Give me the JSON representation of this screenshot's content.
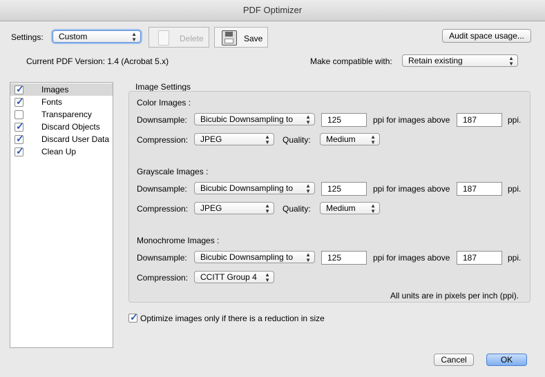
{
  "window": {
    "title": "PDF Optimizer"
  },
  "toolbar": {
    "settings_label": "Settings:",
    "settings_value": "Custom",
    "delete_label": "Delete",
    "save_label": "Save",
    "audit_label": "Audit space usage..."
  },
  "version": {
    "current": "Current PDF Version: 1.4 (Acrobat 5.x)",
    "compat_label": "Make compatible with:",
    "compat_value": "Retain existing"
  },
  "sidebar": {
    "items": [
      {
        "label": "Images",
        "checked": true,
        "selected": true
      },
      {
        "label": "Fonts",
        "checked": true,
        "selected": false
      },
      {
        "label": "Transparency",
        "checked": false,
        "selected": false
      },
      {
        "label": "Discard Objects",
        "checked": true,
        "selected": false
      },
      {
        "label": "Discard User Data",
        "checked": true,
        "selected": false
      },
      {
        "label": "Clean Up",
        "checked": true,
        "selected": false
      }
    ]
  },
  "image_settings": {
    "title": "Image Settings",
    "color": {
      "header": "Color Images :",
      "downsample_label": "Downsample:",
      "downsample_method": "Bicubic Downsampling to",
      "ppi": "125",
      "ppi_above_label": "ppi for images above",
      "above_ppi": "187",
      "ppi_unit": "ppi.",
      "compression_label": "Compression:",
      "compression": "JPEG",
      "quality_label": "Quality:",
      "quality": "Medium"
    },
    "grayscale": {
      "header": "Grayscale Images :",
      "downsample_label": "Downsample:",
      "downsample_method": "Bicubic Downsampling to",
      "ppi": "125",
      "ppi_above_label": "ppi for images above",
      "above_ppi": "187",
      "ppi_unit": "ppi.",
      "compression_label": "Compression:",
      "compression": "JPEG",
      "quality_label": "Quality:",
      "quality": "Medium"
    },
    "monochrome": {
      "header": "Monochrome Images :",
      "downsample_label": "Downsample:",
      "downsample_method": "Bicubic Downsampling to",
      "ppi": "125",
      "ppi_above_label": "ppi for images above",
      "above_ppi": "187",
      "ppi_unit": "ppi.",
      "compression_label": "Compression:",
      "compression": "CCITT Group 4"
    },
    "units_note": "All units are in pixels per inch (ppi)."
  },
  "optimize_only": {
    "label": "Optimize images only if there is a reduction in size",
    "checked": true
  },
  "footer": {
    "cancel_label": "Cancel",
    "ok_label": "OK"
  },
  "colors": {
    "accent": "#4a7fd1",
    "check": "#2b58b0"
  }
}
